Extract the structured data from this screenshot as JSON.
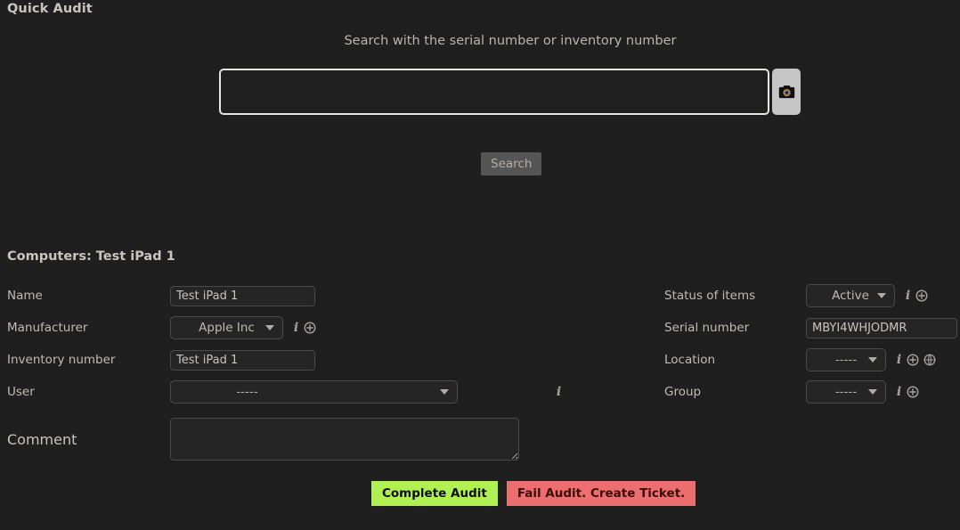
{
  "page": {
    "title": "Quick Audit",
    "record_heading": "Computers: Test iPad 1"
  },
  "search": {
    "hint": "Search with the serial number or inventory number",
    "input_value": "",
    "input_placeholder": "",
    "camera_icon": "camera-icon",
    "button_label": "Search"
  },
  "form": {
    "left": {
      "name": {
        "label": "Name",
        "value": "Test iPad 1"
      },
      "manufacturer": {
        "label": "Manufacturer",
        "value": "Apple Inc",
        "icons": [
          "info-icon",
          "plus-circle-icon"
        ]
      },
      "inventory_number": {
        "label": "Inventory number",
        "value": "Test iPad 1"
      },
      "user": {
        "label": "User",
        "value": "-----",
        "icons": [
          "info-icon"
        ]
      },
      "comment": {
        "label": "Comment",
        "value": "",
        "placeholder": ""
      }
    },
    "right": {
      "status": {
        "label": "Status of items",
        "value": "Active",
        "icons": [
          "info-icon",
          "plus-circle-icon"
        ]
      },
      "serial_number": {
        "label": "Serial number",
        "value": "MBYI4WHJODMR"
      },
      "location": {
        "label": "Location",
        "value": "-----",
        "icons": [
          "info-icon",
          "plus-circle-icon",
          "globe-icon"
        ]
      },
      "group": {
        "label": "Group",
        "value": "-----",
        "icons": [
          "info-icon",
          "plus-circle-icon"
        ]
      }
    }
  },
  "actions": {
    "complete_label": "Complete Audit",
    "fail_label": "Fail Audit. Create Ticket."
  },
  "colors": {
    "background": "#1f1f1f",
    "text": "#c8c3bc",
    "complete_button": "#b1f052",
    "fail_button": "#ec6e6e",
    "search_button": "#555555",
    "camera_button": "#c6c6c6",
    "input_border": "#4a4a4a",
    "search_input_border": "#e8e6e3"
  }
}
